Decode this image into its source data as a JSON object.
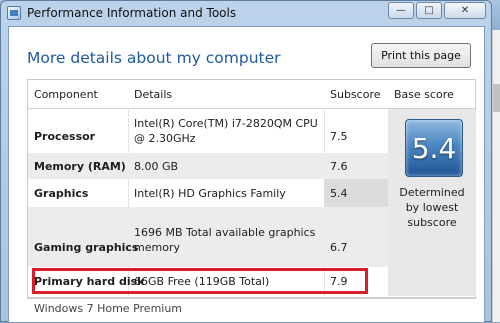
{
  "window": {
    "title": "Performance Information and Tools",
    "minimize_glyph": "—",
    "maximize_glyph": "□",
    "close_glyph": "✕"
  },
  "heading": "More details about my computer",
  "print_button": "Print this page",
  "table": {
    "headers": {
      "component": "Component",
      "details": "Details",
      "subscore": "Subscore",
      "base_score": "Base score"
    },
    "rows": [
      {
        "component": "Processor",
        "details": "Intel(R) Core(TM) i7-2820QM CPU @ 2.30GHz",
        "subscore": "7.5"
      },
      {
        "component": "Memory (RAM)",
        "details": "8.00 GB",
        "subscore": "7.6"
      },
      {
        "component": "Graphics",
        "details": "Intel(R) HD Graphics Family",
        "subscore": "5.4"
      },
      {
        "component": "Gaming graphics",
        "details": "1696 MB Total available graphics memory",
        "subscore": "6.7"
      },
      {
        "component": "Primary hard disk",
        "details": "66GB Free (119GB Total)",
        "subscore": "7.9"
      }
    ]
  },
  "base_score": {
    "value": "5.4",
    "note": "Determined by lowest subscore"
  },
  "edition": "Windows 7 Home Premium",
  "colors": {
    "accent_heading": "#1e5aa0",
    "highlight_border": "#d81e2a",
    "badge_blue": "#4c86c2"
  }
}
